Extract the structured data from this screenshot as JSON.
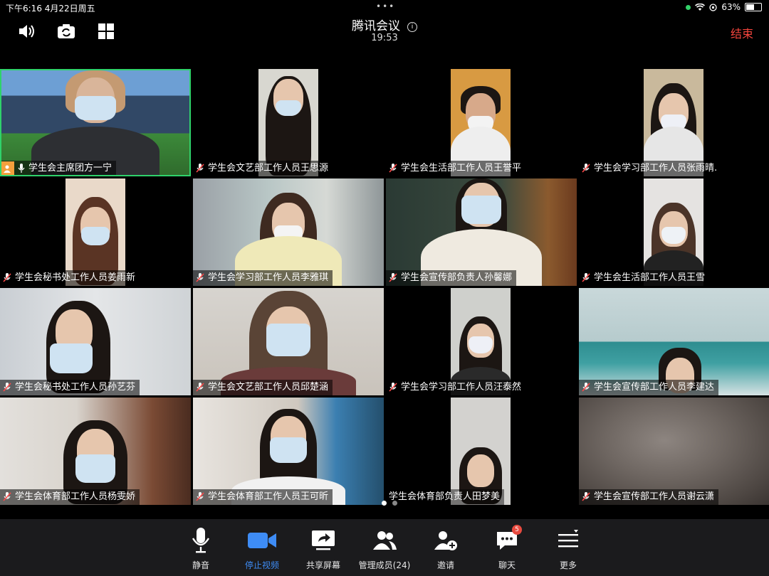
{
  "status_bar": {
    "time_date": "下午6:16   4月22日周五",
    "battery": "63%",
    "battery_level": 0.63
  },
  "header": {
    "title": "腾讯会议",
    "info_icon": "info-icon",
    "timer": "19:53",
    "end_label": "结束"
  },
  "participants": [
    {
      "name": "学生会主席团方一宁",
      "active": true
    },
    {
      "name": "学生会文艺部工作人员王思源"
    },
    {
      "name": "学生会生活部工作人员王誉平"
    },
    {
      "name": "学生会学习部工作人员张雨晴."
    },
    {
      "name": "学生会秘书处工作人员姜雨新"
    },
    {
      "name": "学生会学习部工作人员李雅琪"
    },
    {
      "name": "学生会宣传部负责人孙馨娜"
    },
    {
      "name": "学生会生活部工作人员王雪"
    },
    {
      "name": "学生会秘书处工作人员孙艺芬"
    },
    {
      "name": "学生会文艺部工作人员邱楚涵"
    },
    {
      "name": "学生会学习部工作人员汪泰然"
    },
    {
      "name": "学生会宣传部工作人员李建达"
    },
    {
      "name": "学生会体育部工作人员杨雯娇"
    },
    {
      "name": "学生会体育部工作人员王可昕"
    },
    {
      "name": "学生会体育部负责人田梦美"
    },
    {
      "name": "学生会宣传部工作人员谢云潇"
    }
  ],
  "toolbar": {
    "mute": "静音",
    "stop_video": "停止视频",
    "share_screen": "共享屏幕",
    "manage_members": "管理成员(24)",
    "invite": "邀请",
    "chat": "聊天",
    "chat_badge": "5",
    "more": "更多"
  },
  "colors": {
    "accent_blue": "#3e8cf5",
    "end_red": "#f5453d",
    "active_green": "#2fd26b",
    "toolbar_bg": "#1b1b1d"
  }
}
